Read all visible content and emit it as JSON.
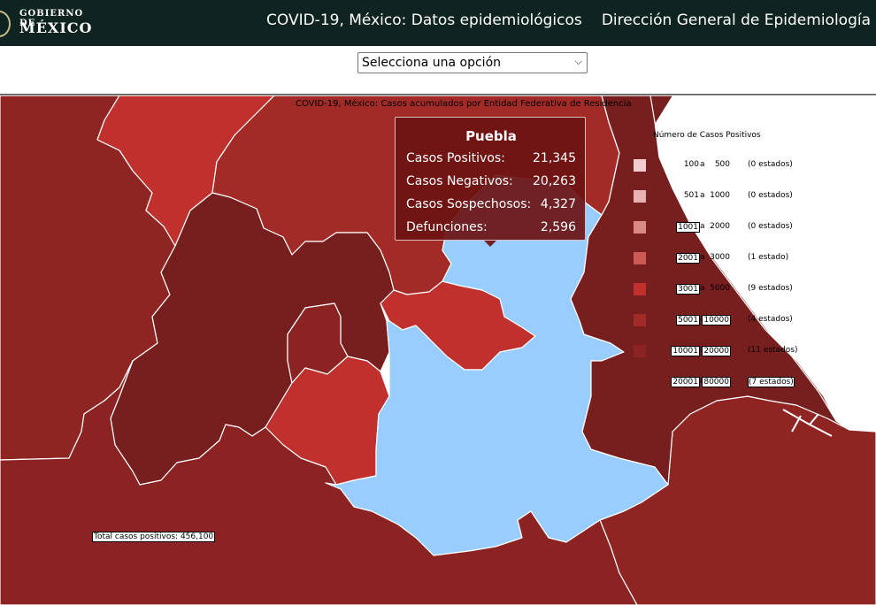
{
  "header": {
    "logo_line1": "GOBIERNO DE",
    "logo_line2": "MÉXICO",
    "app_title": "COVID-19, México: Datos epidemiológicos",
    "agency": "Dirección General de Epidemiología"
  },
  "selector": {
    "value": "Selecciona una opción"
  },
  "map": {
    "title": "COVID-19, México: Casos acumulados por Entidad Federativa de Residencia",
    "hover_state": "Puebla",
    "highlight_color": "#99ccff"
  },
  "tooltip": {
    "title": "Puebla",
    "rows": [
      {
        "label": "Casos Positivos:",
        "value": "21,345"
      },
      {
        "label": "Casos Negativos:",
        "value": "20,263"
      },
      {
        "label": "Casos Sospechosos:",
        "value": "4,327"
      },
      {
        "label": "Defunciones:",
        "value": "2,596"
      }
    ]
  },
  "legend": {
    "title": "Número de Casos Positivos",
    "sep": "a",
    "rows": [
      {
        "from": "100",
        "to": "500",
        "count": "(0 estados)",
        "color": "#f2cfcf"
      },
      {
        "from": "501",
        "to": "1000",
        "count": "(0 estados)",
        "color": "#e9b2b2"
      },
      {
        "from": "1001",
        "to": "2000",
        "count": "(0 estados)",
        "color": "#d98a85"
      },
      {
        "from": "2001",
        "to": "3000",
        "count": "(1 estado)",
        "color": "#cc5b55"
      },
      {
        "from": "3001",
        "to": "5000",
        "count": "(9 estados)",
        "color": "#c0312e"
      },
      {
        "from": "5001",
        "to": "10000",
        "count": "(4 estados)",
        "color": "#a32b27"
      },
      {
        "from": "10001",
        "to": "20000",
        "count": "(11 estados)",
        "color": "#8a2321"
      },
      {
        "from": "20001",
        "to": "80000",
        "count": "(7 estados)",
        "color": "#771e1e"
      }
    ]
  },
  "total": "Total casos positivos: 456,100"
}
